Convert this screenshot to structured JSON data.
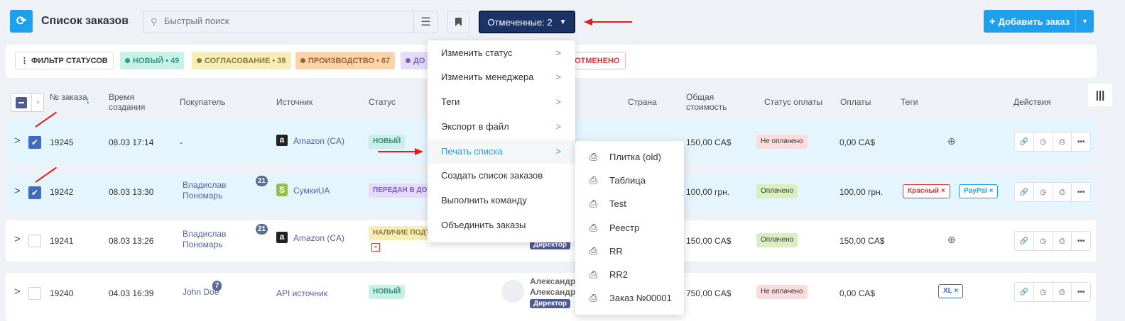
{
  "header": {
    "title": "Список заказов",
    "search_placeholder": "Быстрый поиск",
    "marked_label": "Отмеченные: 2",
    "add_label": "Добавить заказ"
  },
  "filters": {
    "label": "ФИЛЬТР СТАТУСОВ",
    "chips": [
      {
        "label": "НОВЫЙ • 49",
        "color": "#4db89a",
        "bg": "#c5f1e8"
      },
      {
        "label": "СОГЛАСОВАНИЕ • 38",
        "color": "#9a8a3c",
        "bg": "#f6edb7"
      },
      {
        "label": "ПРОИЗВОДСТВО • 67",
        "color": "#a06a3a",
        "bg": "#fcd4a8"
      },
      {
        "label": "ДО",
        "color": "#8670c8",
        "bg": "#e5dcfb"
      },
      {
        "label": "ОТМЕНЕНО",
        "color": "#d33",
        "bg": "#fff"
      }
    ]
  },
  "columns": {
    "num": "№ заказа",
    "created": "Время создания",
    "buyer": "Покупатель",
    "source": "Источник",
    "status": "Статус",
    "country": "Страна",
    "total": "Общая стоимость",
    "pay_status": "Статус оплаты",
    "payments": "Оплаты",
    "tags": "Теги",
    "actions": "Действия"
  },
  "rows": [
    {
      "id": "19245",
      "created": "08.03 17:14",
      "buyer": "-",
      "source": "Amazon (CA)",
      "status": "НОВЫЙ",
      "total": "150,00 CA$",
      "pay_status": "Не оплачено",
      "payments": "0,00 CA$",
      "checked": true
    },
    {
      "id": "19242",
      "created": "08.03 13:30",
      "buyer": "Владислав Пономарь",
      "buyer_badge": "21",
      "source": "СумкиUA",
      "status": "ПЕРЕДАН В ДО",
      "total": "100,00 грн.",
      "pay_status": "Оплачено",
      "payments": "100,00 грн.",
      "tags": [
        "Красный",
        "PayPal"
      ],
      "checked": true
    },
    {
      "id": "19241",
      "created": "08.03 13:26",
      "buyer": "Владислав Пономарь",
      "buyer_badge": "21",
      "source": "Amazon (CA)",
      "status": "НАЛИЧИЕ ПОДТ",
      "manager_role": "Директор",
      "total": "150,00 CA$",
      "pay_status": "Оплачено",
      "payments": "150,00 CA$",
      "checked": false
    },
    {
      "id": "19240",
      "created": "04.03 16:39",
      "buyer": "John Doe",
      "buyer_badge": "7",
      "source": "API источник",
      "status": "НОВЫЙ",
      "manager": "Александр Александр",
      "manager_role": "Директор",
      "total": "750,00 CA$",
      "pay_status": "Не оплачено",
      "payments": "0,00 CA$",
      "tags": [
        "XL"
      ],
      "checked": false
    }
  ],
  "menu": {
    "items": [
      "Изменить статус",
      "Изменить менеджера",
      "Теги",
      "Экспорт в файл",
      "Печать списка",
      "Создать список заказов",
      "Выполнить команду",
      "Объединить заказы"
    ],
    "active": "Печать списка"
  },
  "submenu": {
    "items": [
      "Плитка (old)",
      "Таблица",
      "Test",
      "Реестр",
      "RR",
      "RR2",
      "Заказ №00001"
    ]
  }
}
